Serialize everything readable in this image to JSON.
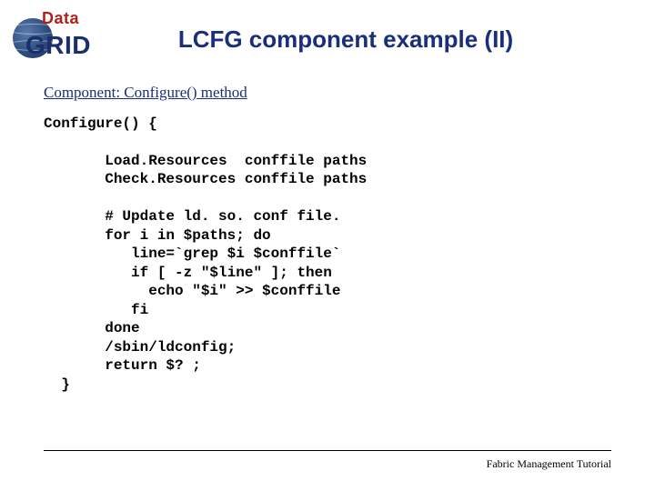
{
  "logo": {
    "top": "Data",
    "bottom": "GRID"
  },
  "title": "LCFG component example (II)",
  "section_label": "Component: Configure() method",
  "code_text": "Configure() {\n\n       Load.Resources  conffile paths\n       Check.Resources conffile paths\n\n       # Update ld. so. conf file.\n       for i in $paths; do\n          line=`grep $i $conffile`\n          if [ -z \"$line\" ]; then\n            echo \"$i\" >> $conffile\n          fi\n       done\n       /sbin/ldconfig;\n       return $? ;\n  }",
  "footer": "Fabric Management Tutorial"
}
